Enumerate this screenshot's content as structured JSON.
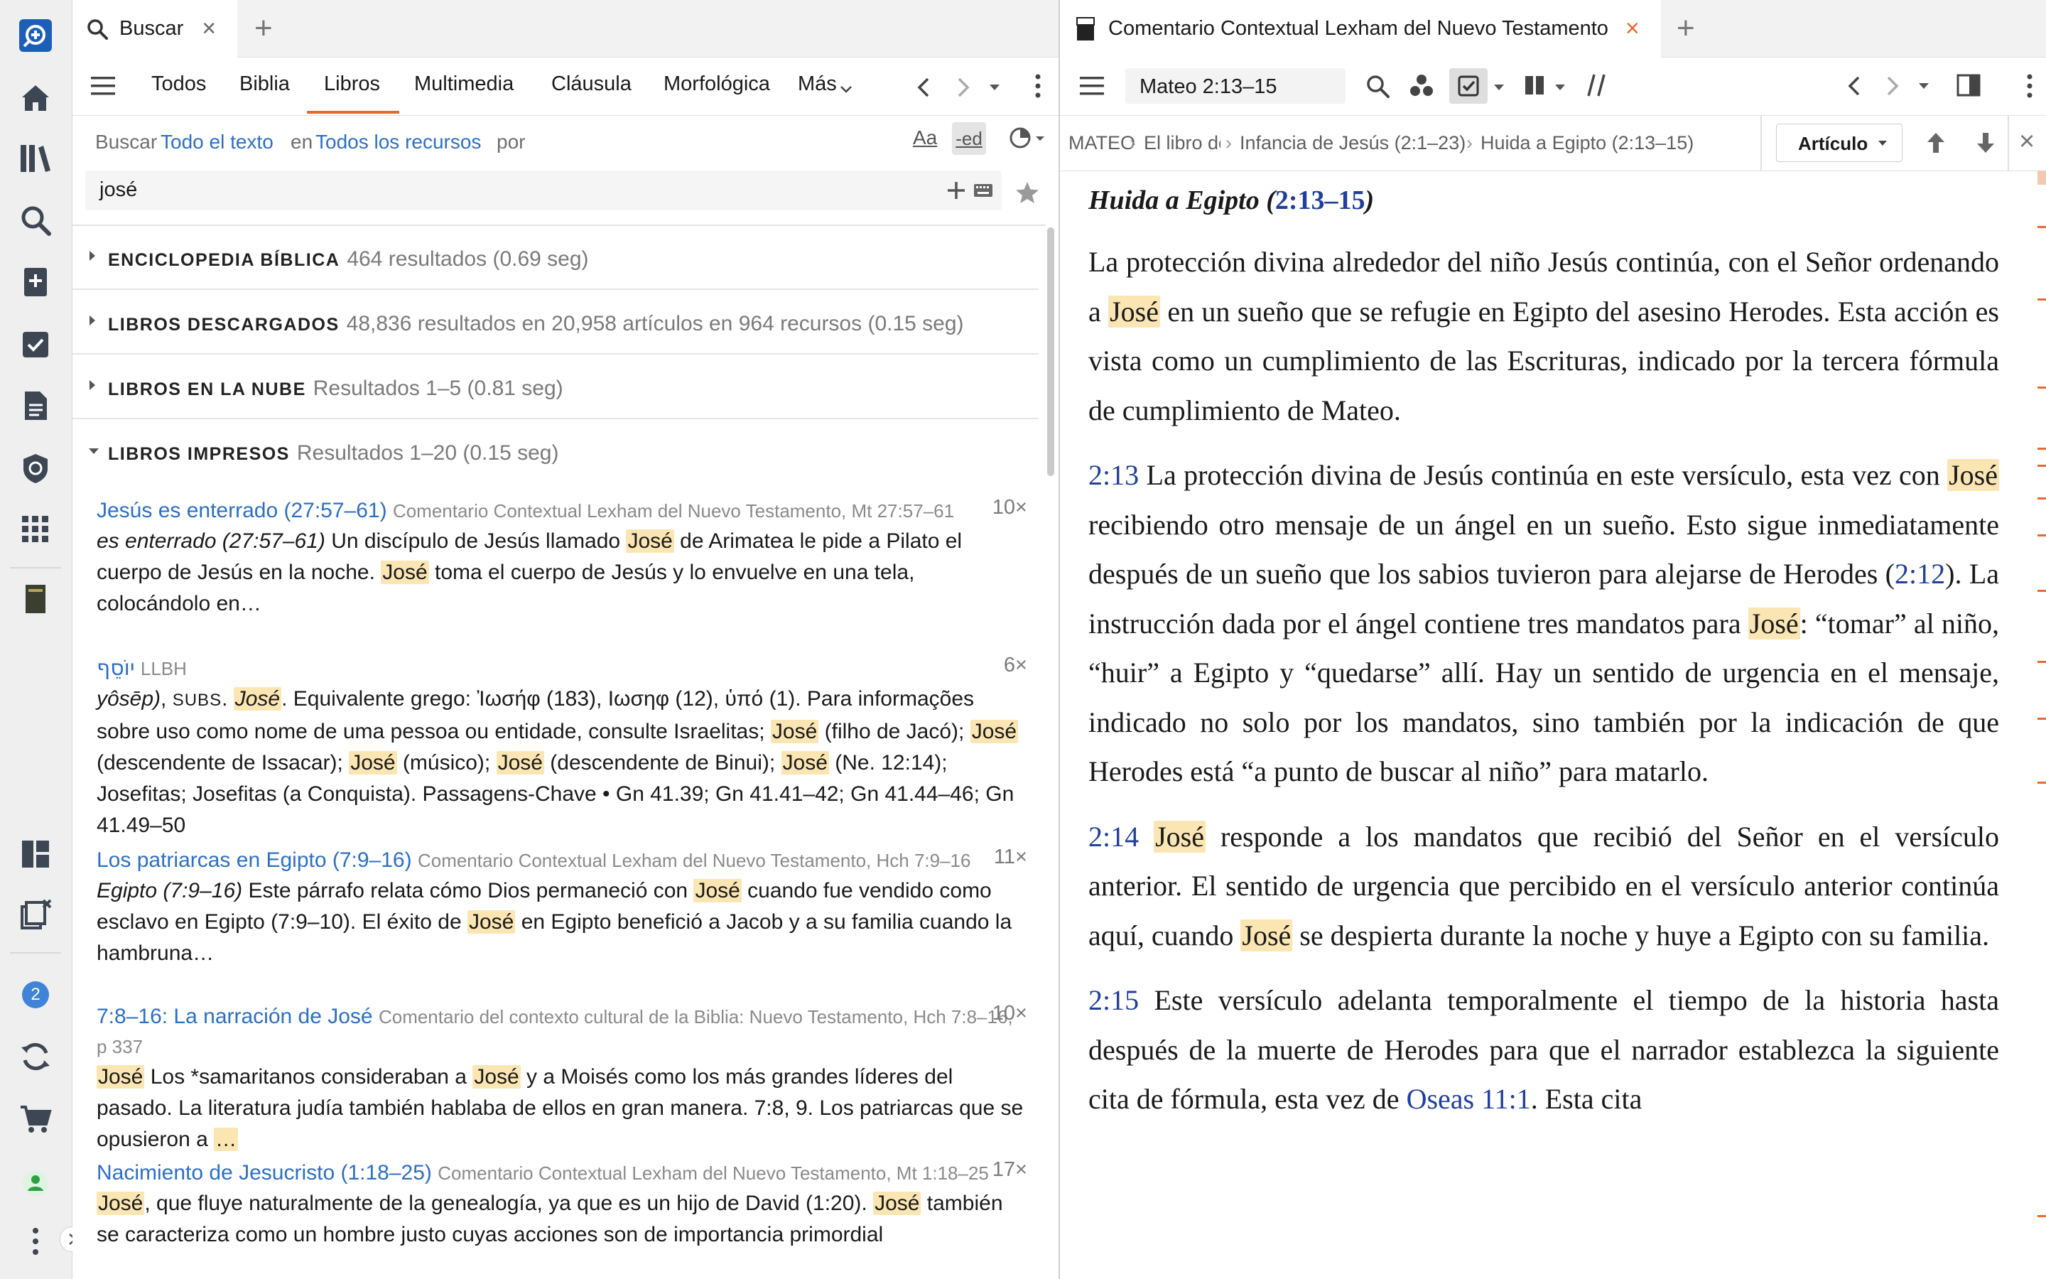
{
  "left_tab": {
    "title": "Buscar"
  },
  "right_tab": {
    "title": "Comentario Contextual Lexham del Nuevo Testamento"
  },
  "search": {
    "categories": [
      "Todos",
      "Biblia",
      "Libros",
      "Multimedia",
      "Cláusula",
      "Morfológica",
      "Más"
    ],
    "active_category": "Libros",
    "prefix": "Buscar",
    "scope": "Todo el texto",
    "in_label": "en",
    "resources": "Todos los recursos",
    "by_label": "por",
    "case_label": "Aa",
    "ending_label": "-ed",
    "query": "josé"
  },
  "sections": [
    {
      "name": "ENCICLOPEDIA BÍBLICA",
      "info": "464 resultados (0.69 seg)",
      "expanded": false
    },
    {
      "name": "LIBROS DESCARGADOS",
      "info": "48,836 resultados en 20,958 artículos en 964 recursos (0.15 seg)",
      "expanded": false
    },
    {
      "name": "LIBROS EN LA NUBE",
      "info": "Resultados 1–5 (0.81 seg)",
      "expanded": false
    },
    {
      "name": "LIBROS IMPRESOS",
      "info": "Resultados 1–20 (0.15 seg)",
      "expanded": true
    }
  ],
  "results": [
    {
      "title": "Jesús es enterrado (27:57–61)",
      "source": "Comentario Contextual Lexham del Nuevo Testamento, Mt 27:57–61",
      "count": "10×",
      "b1": "es enterrado (27:57–61)",
      "b2": " Un discípulo de Jesús llamado ",
      "b3": "José",
      "b4": " de Arimatea le pide a Pilato el cuerpo de Jesús en la noche. ",
      "b5": "José",
      "b6": " toma el cuerpo de Jesús y lo envuelve en una tela, colocándolo en…"
    },
    {
      "title": "יוֹסֵף",
      "source": "LLBH",
      "count": "6×",
      "b1": "yôsēp)",
      "b2": ", ",
      "b3": "SUBS",
      "b4": ". ",
      "b5": "José",
      "b6": ". Equivalente grego: Ἰωσήφ (183), Ιωσηφ (12), ὑπό (1). Para informações sobre uso como nome de uma pessoa ou entidade, consulte Israelitas; ",
      "b7": "José",
      "b8": " (filho de Jacó); ",
      "b9": "José",
      "b10": " (descendente de Issacar); ",
      "b11": "José",
      "b12": " (músico); ",
      "b13": "José",
      "b14": " (descendente de Binui); ",
      "b15": "José",
      "b16": " (Ne. 12:14); Josefitas; Josefitas (a Conquista). Passagens-Chave •    Gn 41.39; Gn 41.41–42; Gn 41.44–46; Gn 41.49–50"
    },
    {
      "title": "Los patriarcas en Egipto (7:9–16)",
      "source": "Comentario Contextual Lexham del Nuevo Testamento, Hch 7:9–16",
      "count": "11×",
      "b1": "Egipto (7:9–16)",
      "b2": " Este párrafo relata cómo Dios permaneció con ",
      "b3": "José",
      "b4": " cuando fue vendido como esclavo en Egipto (7:9–10). El éxito de ",
      "b5": "José",
      "b6": " en Egipto benefició a Jacob y a su familia cuando la hambruna…"
    },
    {
      "title": "7:8–16: La narración de José",
      "source": "Comentario del contexto cultural de la Biblia: Nuevo Testamento, Hch 7:8–16, p 337",
      "count": "10×",
      "b1": "José",
      "b2": " Los *samaritanos consideraban a ",
      "b3": "José",
      "b4": " y a Moisés como los más grandes líderes del pasado. La literatura judía también hablaba de ellos en gran manera. 7:8, 9. Los patriarcas que se opusieron a ",
      "b5": "…"
    },
    {
      "title": "Nacimiento de Jesucristo (1:18–25)",
      "source": "Comentario Contextual Lexham del Nuevo Testamento, Mt 1:18–25",
      "count": "17×",
      "b1": "José",
      "b2": ", que fluye naturalmente de la genealogía, ya que es un hijo de David (1:20). ",
      "b3": "José",
      "b4": " también se caracteriza como un hombre justo cuyas acciones son de importancia primordial"
    }
  ],
  "reader": {
    "reference": "Mateo 2:13–15",
    "breadcrumbs": [
      "MATEO",
      "El libro de lo",
      "Infancia de Jesús (2:1–23)",
      "Huida a Egipto (2:13–15)"
    ],
    "view_button": "Artículo",
    "heading": "Huida a Egipto (",
    "heading_ref": "2:13–15",
    "heading_end": ")",
    "p1": {
      "a": "La protección divina alrededor del niño Jesús continúa, con el Señor ordenando a ",
      "h": "José",
      "b": " en un sueño que se refugie en Egipto del asesino Herodes. Esta acción es vista como un cumplimiento de las Escrituras, indicado por la tercera fórmula de cumplimiento de Mateo."
    },
    "p2": {
      "v": "2:13",
      "a": " La protección divina de Jesús continúa en este versículo, esta vez con ",
      "h1": "José",
      "b": " recibiendo otro mensaje de un ángel en un sueño. Esto sigue inmediatamente después de un sueño que los sabios tuvieron para alejarse de Herodes (",
      "ref": "2:12",
      "c": "). La instrucción dada por el ángel contiene tres mandatos para ",
      "h2": "José",
      "d": ": “tomar” al niño, “huir” a Egipto y “quedarse” allí. Hay un sentido de urgencia en el mensaje, indicado no solo por los mandatos, sino también por la indicación de que Herodes está “a punto de buscar al niño” para matarlo."
    },
    "p3": {
      "v": "2:14",
      "h1": "José",
      "a": " responde a los mandatos que recibió del Señor en el versículo anterior. El sentido de urgencia que percibido en el versículo anterior continúa aquí, cuando ",
      "h2": "José",
      "b": " se despierta durante la noche y huye a Egipto con su familia."
    },
    "p4": {
      "v": "2:15",
      "a": " Este versículo adelanta temporalmente el tiempo de la historia hasta después de la muerte de Herodes para que el narrador establezca la siguiente cita de fórmula, esta vez de ",
      "ref": "Oseas 11:1",
      "b": ". Esta cita"
    }
  },
  "rail": {
    "badge": "2"
  },
  "colors": {
    "accent": "#e8692d",
    "link": "#2c6fc5",
    "verse": "#1f3f9a",
    "highlight": "#fbe6b3"
  }
}
